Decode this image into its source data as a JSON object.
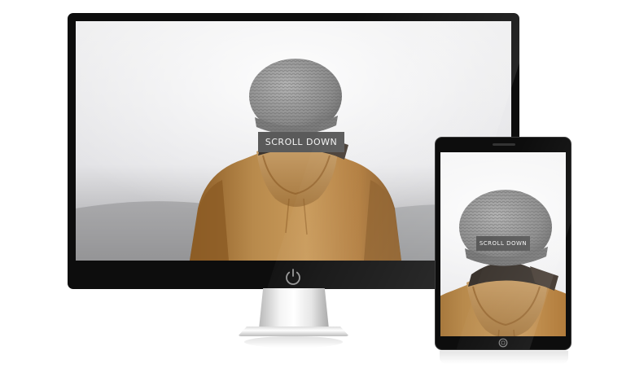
{
  "monitor": {
    "scroll_label": "SCROLL  DOWN",
    "power_icon": "power-icon"
  },
  "tablet": {
    "scroll_label": "SCROLL  DOWN",
    "home_icon": "home-button-icon"
  },
  "colors": {
    "device_frame": "#0d0d0d",
    "scroll_button_bg": "#5a5a5a",
    "jacket": "#b07a3a",
    "beanie": "#8a8a8a",
    "fog_background": "#e9e9ec"
  }
}
